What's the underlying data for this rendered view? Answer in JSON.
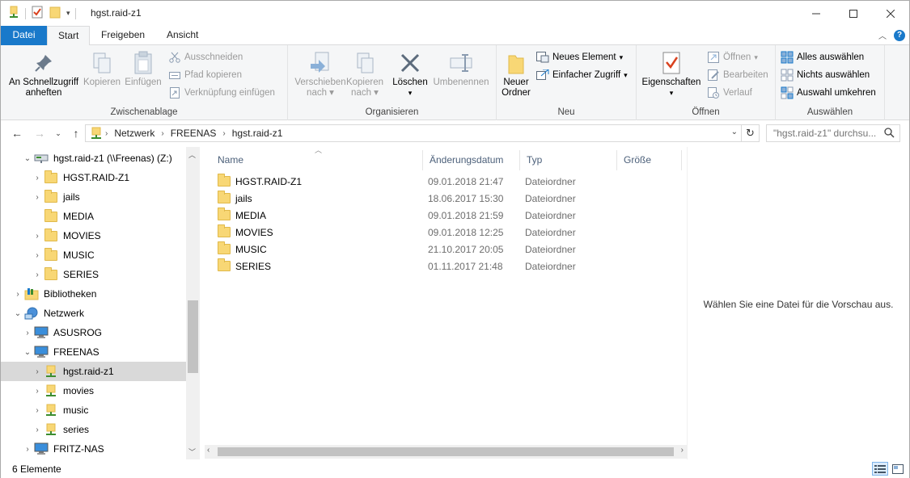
{
  "window": {
    "title": "hgst.raid-z1",
    "minimize_icon": "minimize-icon",
    "maximize_icon": "maximize-icon",
    "close_icon": "close-icon"
  },
  "ribbon_tabs": [
    "Datei",
    "Start",
    "Freigeben",
    "Ansicht"
  ],
  "ribbon": {
    "clipboard": {
      "label": "Zwischenablage",
      "pin_line1": "An Schnellzugriff",
      "pin_line2": "anheften",
      "copy": "Kopieren",
      "paste": "Einfügen",
      "cut": "Ausschneiden",
      "copy_path": "Pfad kopieren",
      "paste_shortcut": "Verknüpfung einfügen"
    },
    "organize": {
      "label": "Organisieren",
      "move_line1": "Verschieben",
      "move_line2": "nach",
      "copy_line1": "Kopieren",
      "copy_line2": "nach",
      "delete": "Löschen",
      "rename": "Umbenennen"
    },
    "new": {
      "label": "Neu",
      "new_folder_line1": "Neuer",
      "new_folder_line2": "Ordner",
      "new_item": "Neues Element",
      "easy_access": "Einfacher Zugriff"
    },
    "open": {
      "label": "Öffnen",
      "properties": "Eigenschaften",
      "open": "Öffnen",
      "edit": "Bearbeiten",
      "history": "Verlauf"
    },
    "select": {
      "label": "Auswählen",
      "select_all": "Alles auswählen",
      "select_none": "Nichts auswählen",
      "invert": "Auswahl umkehren"
    }
  },
  "address": {
    "crumbs": [
      "Netzwerk",
      "FREENAS",
      "hgst.raid-z1"
    ],
    "search_placeholder": "\"hgst.raid-z1\" durchsu..."
  },
  "nav_tree": [
    {
      "label": "hgst.raid-z1 (\\\\Freenas) (Z:)",
      "level": 1,
      "expander": "expanded",
      "icon": "network-drive-icon"
    },
    {
      "label": "HGST.RAID-Z1",
      "level": 2,
      "expander": "collapsed",
      "icon": "folder-icon"
    },
    {
      "label": "jails",
      "level": 2,
      "expander": "collapsed",
      "icon": "folder-icon"
    },
    {
      "label": "MEDIA",
      "level": 2,
      "expander": "none",
      "icon": "folder-icon"
    },
    {
      "label": "MOVIES",
      "level": 2,
      "expander": "collapsed",
      "icon": "folder-icon"
    },
    {
      "label": "MUSIC",
      "level": 2,
      "expander": "collapsed",
      "icon": "folder-icon"
    },
    {
      "label": "SERIES",
      "level": 2,
      "expander": "collapsed",
      "icon": "folder-icon"
    },
    {
      "label": "Bibliotheken",
      "level": 0,
      "expander": "collapsed",
      "icon": "libraries-icon"
    },
    {
      "label": "Netzwerk",
      "level": 0,
      "expander": "expanded",
      "icon": "network-icon"
    },
    {
      "label": "ASUSROG",
      "level": 1,
      "expander": "collapsed",
      "icon": "computer-icon"
    },
    {
      "label": "FREENAS",
      "level": 1,
      "expander": "expanded",
      "icon": "computer-icon"
    },
    {
      "label": "hgst.raid-z1",
      "level": 2,
      "expander": "collapsed",
      "icon": "network-share-icon",
      "selected": true
    },
    {
      "label": "movies",
      "level": 2,
      "expander": "collapsed",
      "icon": "network-share-icon"
    },
    {
      "label": "music",
      "level": 2,
      "expander": "collapsed",
      "icon": "network-share-icon"
    },
    {
      "label": "series",
      "level": 2,
      "expander": "collapsed",
      "icon": "network-share-icon"
    },
    {
      "label": "FRITZ-NAS",
      "level": 1,
      "expander": "collapsed",
      "icon": "computer-icon"
    }
  ],
  "file_columns": [
    "Name",
    "Änderungsdatum",
    "Typ",
    "Größe"
  ],
  "files": [
    {
      "name": "HGST.RAID-Z1",
      "date": "09.01.2018 21:47",
      "type": "Dateiordner"
    },
    {
      "name": "jails",
      "date": "18.06.2017 15:30",
      "type": "Dateiordner"
    },
    {
      "name": "MEDIA",
      "date": "09.01.2018 21:59",
      "type": "Dateiordner"
    },
    {
      "name": "MOVIES",
      "date": "09.01.2018 12:25",
      "type": "Dateiordner"
    },
    {
      "name": "MUSIC",
      "date": "21.10.2017 20:05",
      "type": "Dateiordner"
    },
    {
      "name": "SERIES",
      "date": "01.11.2017 21:48",
      "type": "Dateiordner"
    }
  ],
  "preview_text": "Wählen Sie eine Datei für die Vorschau aus.",
  "status": {
    "count": "6 Elemente"
  },
  "colors": {
    "file_tab": "#1979ca",
    "ribbon_bg": "#f5f6f7",
    "selected_row": "#d9d9d9",
    "folder": "#f8d775"
  }
}
